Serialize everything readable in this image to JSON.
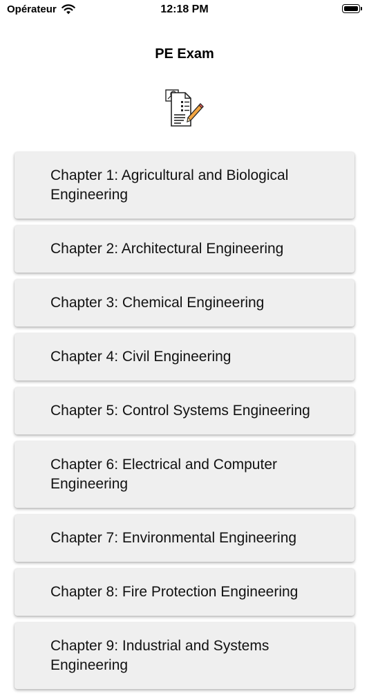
{
  "status_bar": {
    "carrier": "Opérateur",
    "time": "12:18 PM",
    "icons": [
      "wifi-icon",
      "battery-icon"
    ]
  },
  "nav": {
    "title": "PE Exam"
  },
  "logo": {
    "icon": "exam-document-icon"
  },
  "chapters": [
    {
      "label": "Chapter 1: Agricultural and Biological Engineering"
    },
    {
      "label": "Chapter 2: Architectural Engineering"
    },
    {
      "label": "Chapter 3: Chemical Engineering"
    },
    {
      "label": "Chapter 4: Civil Engineering"
    },
    {
      "label": "Chapter 5: Control Systems Engineering"
    },
    {
      "label": "Chapter 6: Electrical and Computer Engineering"
    },
    {
      "label": "Chapter 7: Environmental Engineering"
    },
    {
      "label": "Chapter 8: Fire Protection Engineering"
    },
    {
      "label": "Chapter 9: Industrial and Systems Engineering"
    }
  ]
}
